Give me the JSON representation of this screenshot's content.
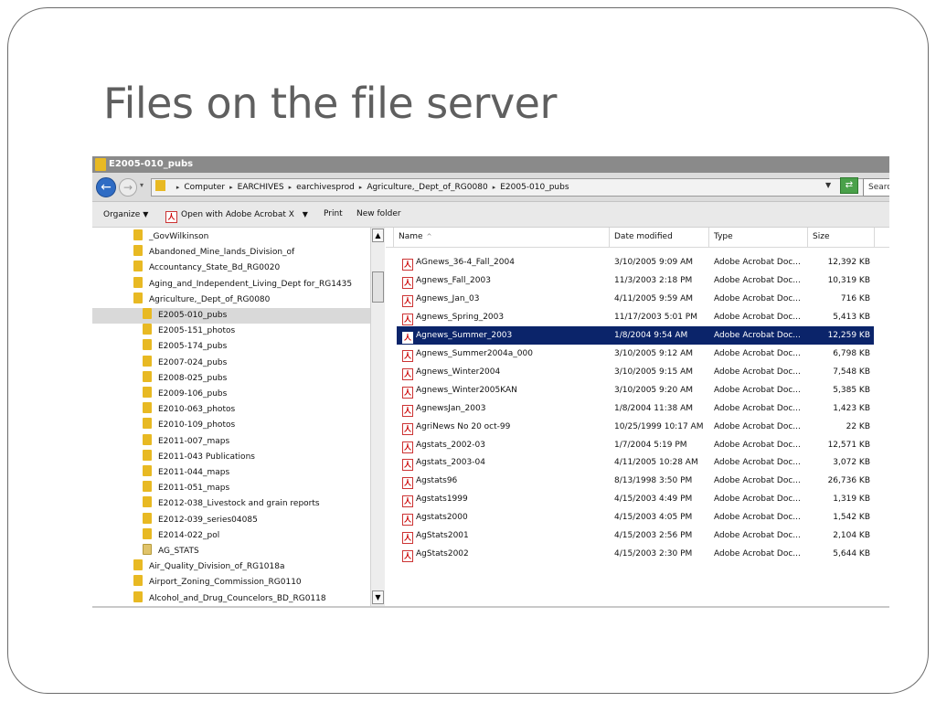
{
  "slide": {
    "title": "Files on the file server"
  },
  "window": {
    "title": "E2005-010_pubs",
    "address": [
      "Computer",
      "EARCHIVES",
      "earchivesprod",
      "Agriculture,_Dept_of_RG0080",
      "E2005-010_pubs"
    ],
    "search_placeholder": "Searc",
    "toolbar": {
      "organize": "Organize",
      "open_with": "Open with Adobe Acrobat X",
      "print": "Print",
      "new_folder": "New folder"
    }
  },
  "nav_tree": [
    {
      "label": "_GovWilkinson",
      "level": 0
    },
    {
      "label": "Abandoned_Mine_lands_Division_of",
      "level": 0
    },
    {
      "label": "Accountancy_State_Bd_RG0020",
      "level": 0
    },
    {
      "label": "Aging_and_Independent_Living_Dept for_RG1435",
      "level": 0
    },
    {
      "label": "Agriculture,_Dept_of_RG0080",
      "level": 0
    },
    {
      "label": "E2005-010_pubs",
      "level": 1,
      "selected": true
    },
    {
      "label": "E2005-151_photos",
      "level": 1
    },
    {
      "label": "E2005-174_pubs",
      "level": 1
    },
    {
      "label": "E2007-024_pubs",
      "level": 1
    },
    {
      "label": "E2008-025_pubs",
      "level": 1
    },
    {
      "label": "E2009-106_pubs",
      "level": 1
    },
    {
      "label": "E2010-063_photos",
      "level": 1
    },
    {
      "label": "E2010-109_photos",
      "level": 1
    },
    {
      "label": "E2011-007_maps",
      "level": 1
    },
    {
      "label": "E2011-043 Publications",
      "level": 1
    },
    {
      "label": "E2011-044_maps",
      "level": 1
    },
    {
      "label": "E2011-051_maps",
      "level": 1
    },
    {
      "label": "E2012-038_Livestock and grain reports",
      "level": 1
    },
    {
      "label": "E2012-039_series04085",
      "level": 1
    },
    {
      "label": "E2014-022_pol",
      "level": 1
    },
    {
      "label": "AG_STATS",
      "level": 1,
      "icon": "stats"
    },
    {
      "label": "Air_Quality_Division_of_RG1018a",
      "level": 0
    },
    {
      "label": "Airport_Zoning_Commission_RG0110",
      "level": 0
    },
    {
      "label": "Alcohol_and_Drug_Councelors_BD_RG0118",
      "level": 0
    }
  ],
  "columns": {
    "name": "Name",
    "date": "Date modified",
    "type": "Type",
    "size": "Size"
  },
  "pdf_glyph": "人",
  "files": [
    {
      "name": "AGnews_36-4_Fall_2004",
      "date": "3/10/2005 9:09 AM",
      "type": "Adobe Acrobat Doc...",
      "size": "12,392 KB"
    },
    {
      "name": "Agnews_Fall_2003",
      "date": "11/3/2003 2:18 PM",
      "type": "Adobe Acrobat Doc...",
      "size": "10,319 KB"
    },
    {
      "name": "Agnews_Jan_03",
      "date": "4/11/2005 9:59 AM",
      "type": "Adobe Acrobat Doc...",
      "size": "716 KB"
    },
    {
      "name": "Agnews_Spring_2003",
      "date": "11/17/2003 5:01 PM",
      "type": "Adobe Acrobat Doc...",
      "size": "5,413 KB"
    },
    {
      "name": "Agnews_Summer_2003",
      "date": "1/8/2004 9:54 AM",
      "type": "Adobe Acrobat Doc...",
      "size": "12,259 KB",
      "selected": true
    },
    {
      "name": "Agnews_Summer2004a_000",
      "date": "3/10/2005 9:12 AM",
      "type": "Adobe Acrobat Doc...",
      "size": "6,798 KB"
    },
    {
      "name": "Agnews_Winter2004",
      "date": "3/10/2005 9:15 AM",
      "type": "Adobe Acrobat Doc...",
      "size": "7,548 KB"
    },
    {
      "name": "Agnews_Winter2005KAN",
      "date": "3/10/2005 9:20 AM",
      "type": "Adobe Acrobat Doc...",
      "size": "5,385 KB"
    },
    {
      "name": "AgnewsJan_2003",
      "date": "1/8/2004 11:38 AM",
      "type": "Adobe Acrobat Doc...",
      "size": "1,423 KB"
    },
    {
      "name": "AgriNews No 20 oct-99",
      "date": "10/25/1999 10:17 AM",
      "type": "Adobe Acrobat Doc...",
      "size": "22 KB"
    },
    {
      "name": "Agstats_2002-03",
      "date": "1/7/2004 5:19 PM",
      "type": "Adobe Acrobat Doc...",
      "size": "12,571 KB"
    },
    {
      "name": "Agstats_2003-04",
      "date": "4/11/2005 10:28 AM",
      "type": "Adobe Acrobat Doc...",
      "size": "3,072 KB"
    },
    {
      "name": "Agstats96",
      "date": "8/13/1998 3:50 PM",
      "type": "Adobe Acrobat Doc...",
      "size": "26,736 KB"
    },
    {
      "name": "Agstats1999",
      "date": "4/15/2003 4:49 PM",
      "type": "Adobe Acrobat Doc...",
      "size": "1,319 KB"
    },
    {
      "name": "Agstats2000",
      "date": "4/15/2003 4:05 PM",
      "type": "Adobe Acrobat Doc...",
      "size": "1,542 KB"
    },
    {
      "name": "AgStats2001",
      "date": "4/15/2003 2:56 PM",
      "type": "Adobe Acrobat Doc...",
      "size": "2,104 KB"
    },
    {
      "name": "AgStats2002",
      "date": "4/15/2003 2:30 PM",
      "type": "Adobe Acrobat Doc...",
      "size": "5,644 KB"
    }
  ]
}
